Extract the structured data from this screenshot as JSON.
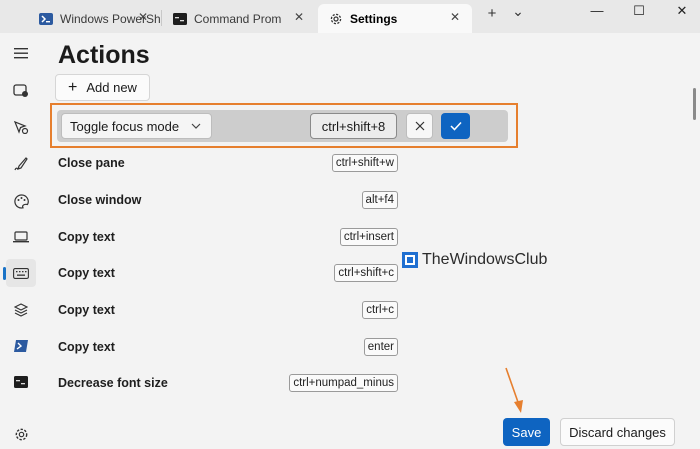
{
  "tabs": [
    {
      "label": "Windows PowerShell",
      "icon": "powershell-icon",
      "active": false
    },
    {
      "label": "Command Prompt",
      "icon": "cmd-icon",
      "active": false
    },
    {
      "label": "Settings",
      "icon": "gear-icon",
      "active": true
    }
  ],
  "titlebar": {
    "new_tab": "+",
    "dropdown": "⌄",
    "minimize": "—",
    "maximize": "☐",
    "close": "✕",
    "tab_close": "✕"
  },
  "sidebar": {
    "items": [
      "menu-icon",
      "startup-icon",
      "interaction-icon",
      "appearance-icon",
      "color-schemes-icon",
      "rendering-icon",
      "actions-icon",
      "profile-defaults-icon",
      "powershell-profile-icon",
      "cmd-profile-icon"
    ],
    "settings_icon": "gear-icon"
  },
  "page": {
    "title": "Actions",
    "add_new": "Add new"
  },
  "editor": {
    "action": "Toggle focus mode",
    "keys": "ctrl+shift+8"
  },
  "actions": [
    {
      "name": "Close pane",
      "keys": "ctrl+shift+w"
    },
    {
      "name": "Close window",
      "keys": "alt+f4"
    },
    {
      "name": "Copy text",
      "keys": "ctrl+insert"
    },
    {
      "name": "Copy text",
      "keys": "ctrl+shift+c"
    },
    {
      "name": "Copy text",
      "keys": "ctrl+c"
    },
    {
      "name": "Copy text",
      "keys": "enter"
    },
    {
      "name": "Decrease font size",
      "keys": "ctrl+numpad_minus"
    }
  ],
  "watermark": "TheWindowsClub",
  "footer": {
    "save": "Save",
    "discard": "Discard changes"
  },
  "colors": {
    "accent": "#0e64c1",
    "highlight": "#e67f2e",
    "annotation_arrow": "#e67f2e"
  }
}
